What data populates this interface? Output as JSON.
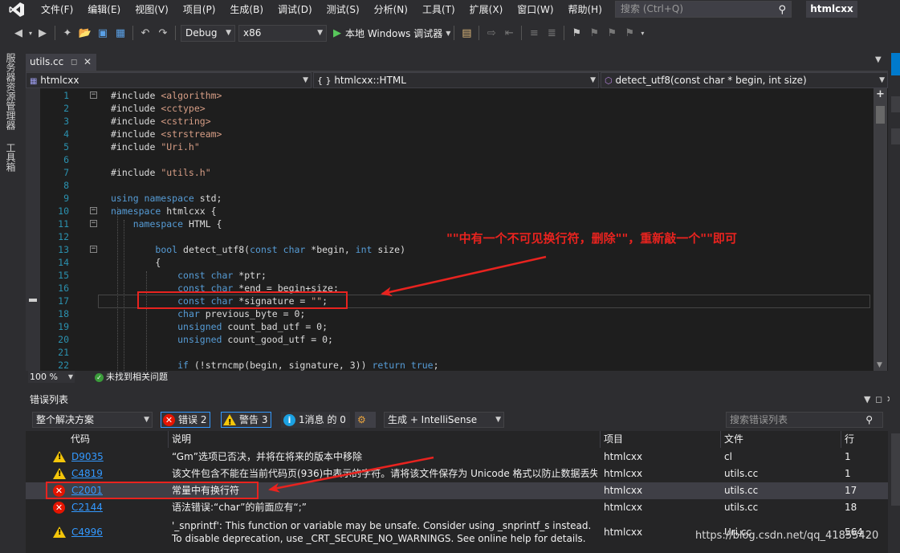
{
  "menubar": {
    "items": [
      "文件(F)",
      "编辑(E)",
      "视图(V)",
      "项目(P)",
      "生成(B)",
      "调试(D)",
      "测试(S)",
      "分析(N)",
      "工具(T)",
      "扩展(X)",
      "窗口(W)",
      "帮助(H)"
    ],
    "search_placeholder": "搜索 (Ctrl+Q)",
    "project_name": "htmlcxx"
  },
  "toolbar": {
    "configuration": "Debug",
    "platform": "x86",
    "run_label": "本地 Windows 调试器"
  },
  "left_tabs": [
    "服务器资源管理器",
    "工具箱"
  ],
  "document_tab": {
    "title": "utils.cc"
  },
  "navbar": {
    "project": "htmlcxx",
    "scope": "htmlcxx::HTML",
    "member": "detect_utf8(const char * begin, int size)"
  },
  "editor": {
    "lines": [
      {
        "n": "1",
        "html": "#include <span class='str'>&lt;algorithm&gt;</span>"
      },
      {
        "n": "2",
        "html": "#include <span class='str'>&lt;cctype&gt;</span>"
      },
      {
        "n": "3",
        "html": "#include <span class='str'>&lt;cstring&gt;</span>"
      },
      {
        "n": "4",
        "html": "#include <span class='str'>&lt;strstream&gt;</span>"
      },
      {
        "n": "5",
        "html": "#include <span class='str'>\"Uri.h\"</span>"
      },
      {
        "n": "6",
        "html": ""
      },
      {
        "n": "7",
        "html": "#include <span class='str'>\"utils.h\"</span>"
      },
      {
        "n": "8",
        "html": ""
      },
      {
        "n": "9",
        "html": "<span class='kw'>using namespace</span> std;"
      },
      {
        "n": "10",
        "html": "<span class='kw'>namespace</span> htmlcxx {"
      },
      {
        "n": "11",
        "html": "    <span class='kw'>namespace</span> HTML {"
      },
      {
        "n": "12",
        "html": ""
      },
      {
        "n": "13",
        "html": "        <span class='kw'>bool</span> detect_utf8(<span class='kw'>const char</span> *begin, <span class='kw'>int</span> size)"
      },
      {
        "n": "14",
        "html": "        {"
      },
      {
        "n": "15",
        "html": "            <span class='kw'>const char</span> *ptr;"
      },
      {
        "n": "16",
        "html": "            <span class='kw'>const char</span> *end = begin+size;"
      },
      {
        "n": "17",
        "html": "            <span class='kw'>const char</span> *signature = <span class='str'>\"\"</span>;"
      },
      {
        "n": "18",
        "html": "            <span class='kw'>char</span> previous_byte = 0;"
      },
      {
        "n": "19",
        "html": "            <span class='kw'>unsigned</span> count_bad_utf = 0;"
      },
      {
        "n": "20",
        "html": "            <span class='kw'>unsigned</span> count_good_utf = 0;"
      },
      {
        "n": "21",
        "html": ""
      },
      {
        "n": "22",
        "html": "            <span class='kw'>if</span> (!strncmp(begin, signature, 3)) <span class='kw'>return true</span>;"
      }
    ],
    "folds": [
      "1",
      "10",
      "11",
      "13"
    ],
    "zoom": "100 %",
    "status": "未找到相关问题"
  },
  "annotation": {
    "text": "\"\"中有一个不可见换行符，删除\"\"，重新敲一个\"\"即可"
  },
  "error_list": {
    "title": "错误列表",
    "scope": "整个解决方案",
    "errors_label": "错误 2",
    "warnings_label": "警告 3",
    "messages_label": "1消息 的 0",
    "build_filter": "生成 + IntelliSense",
    "search_placeholder": "搜索错误列表",
    "columns": [
      "代码",
      "说明",
      "项目",
      "文件",
      "行"
    ],
    "rows": [
      {
        "type": "warning",
        "code": "D9035",
        "desc": "“Gm”选项已否决，并将在将来的版本中移除",
        "project": "htmlcxx",
        "file": "cl",
        "line": "1"
      },
      {
        "type": "warning",
        "code": "C4819",
        "desc": "该文件包含不能在当前代码页(936)中表示的字符。请将该文件保存为 Unicode 格式以防止数据丢失",
        "project": "htmlcxx",
        "file": "utils.cc",
        "line": "1"
      },
      {
        "type": "error",
        "code": "C2001",
        "desc": "常量中有换行符",
        "project": "htmlcxx",
        "file": "utils.cc",
        "line": "17"
      },
      {
        "type": "error",
        "code": "C2144",
        "desc": "语法错误:“char”的前面应有“;”",
        "project": "htmlcxx",
        "file": "utils.cc",
        "line": "18"
      },
      {
        "type": "warning",
        "code": "C4996",
        "desc": "'_snprintf': This function or variable may be unsafe. Consider using _snprintf_s instead. To disable deprecation, use _CRT_SECURE_NO_WARNINGS. See online help for details.",
        "project": "htmlcxx",
        "file": "Uri.cc",
        "line": "564"
      }
    ]
  },
  "watermark": "https://blog.csdn.net/qq_41855420",
  "colors": {
    "background": "#2d2d30",
    "editor": "#1e1e1e",
    "keyword": "#569cd6",
    "string": "#d69d85",
    "line_number": "#2b91af",
    "annotation_red": "#e8231f",
    "link": "#3399ff"
  }
}
